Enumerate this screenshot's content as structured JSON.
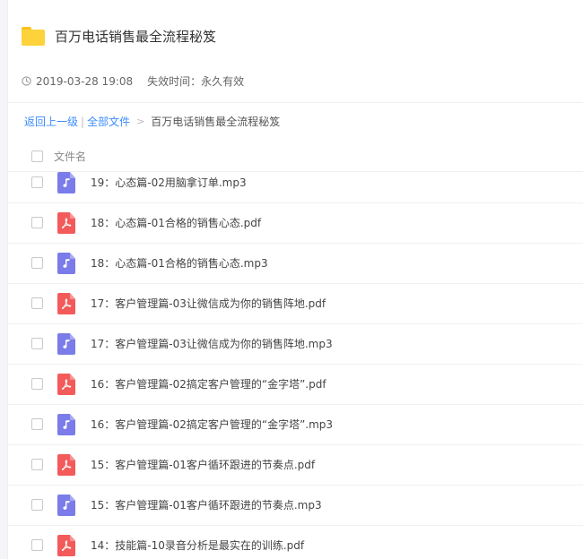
{
  "share": {
    "title": "百万电话销售最全流程秘笈",
    "date": "2019-03-28 19:08",
    "expire": "失效时间：永久有效"
  },
  "breadcrumb": {
    "back": "返回上一级",
    "sep": "|",
    "all": "全部文件",
    "arrow": ">",
    "current": "百万电话销售最全流程秘笈"
  },
  "list": {
    "column_name": "文件名"
  },
  "files": [
    {
      "name": "19：心态篇-02用脑拿订单.mp3",
      "type": "mp3"
    },
    {
      "name": "18：心态篇-01合格的销售心态.pdf",
      "type": "pdf"
    },
    {
      "name": "18：心态篇-01合格的销售心态.mp3",
      "type": "mp3"
    },
    {
      "name": "17：客户管理篇-03让微信成为你的销售阵地.pdf",
      "type": "pdf"
    },
    {
      "name": "17：客户管理篇-03让微信成为你的销售阵地.mp3",
      "type": "mp3"
    },
    {
      "name": "16：客户管理篇-02搞定客户管理的“金字塔”.pdf",
      "type": "pdf"
    },
    {
      "name": "16：客户管理篇-02搞定客户管理的“金字塔”.mp3",
      "type": "mp3"
    },
    {
      "name": "15：客户管理篇-01客户循环跟进的节奏点.pdf",
      "type": "pdf"
    },
    {
      "name": "15：客户管理篇-01客户循环跟进的节奏点.mp3",
      "type": "mp3"
    },
    {
      "name": "14：技能篇-10录音分析是最实在的训练.pdf",
      "type": "pdf"
    }
  ],
  "colors": {
    "link": "#3b8cff",
    "folder": "#fdd23a",
    "mp3_icon": "#7b7ce9",
    "pdf_icon": "#f35b5b"
  }
}
